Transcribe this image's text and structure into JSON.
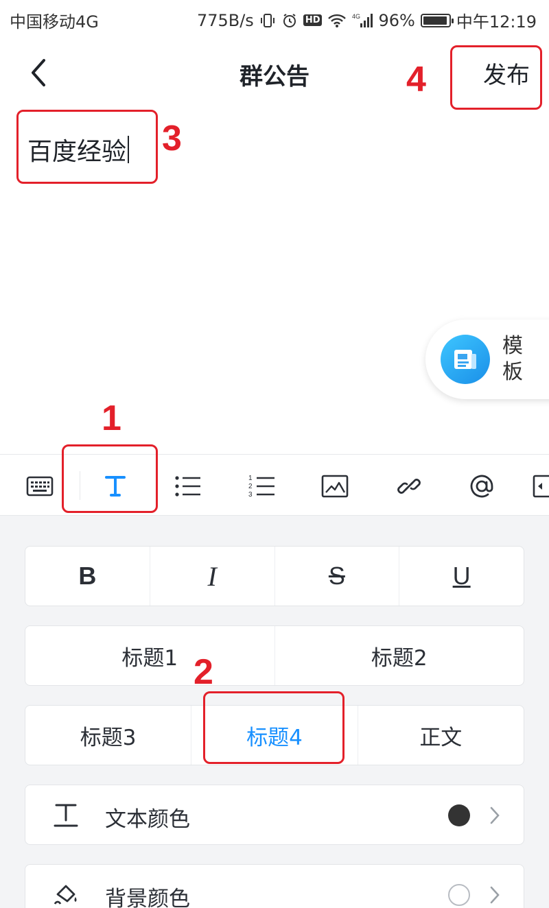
{
  "status_bar": {
    "carrier": "中国移动4G",
    "net_speed": "775B/s",
    "hd": "HD",
    "network": "4G",
    "battery_percent": "96%",
    "battery_level": 0.96,
    "time": "中午12:19"
  },
  "header": {
    "title": "群公告",
    "publish_label": "发布"
  },
  "editor": {
    "content": "百度经验"
  },
  "template": {
    "label": "模板"
  },
  "toolbar": {
    "items": [
      "keyboard-icon",
      "text-format-icon",
      "bullet-list-icon",
      "numbered-list-icon",
      "image-icon",
      "link-icon",
      "at-mention-icon",
      "more-icon"
    ],
    "active": "text-format-icon",
    "active_color": "#1890ff"
  },
  "format": {
    "styles": [
      "B",
      "I",
      "S",
      "U"
    ],
    "headings_row1": [
      "标题1",
      "标题2"
    ],
    "headings_row2": [
      "标题3",
      "标题4",
      "正文"
    ],
    "selected_heading": "标题4",
    "text_color": {
      "label": "文本颜色",
      "value": "#333333"
    },
    "bg_color": {
      "label": "背景颜色",
      "value": "#ffffff"
    }
  },
  "annotations": [
    "1",
    "2",
    "3",
    "4"
  ],
  "colors": {
    "accent": "#1890ff",
    "annotation": "#e3202a"
  }
}
